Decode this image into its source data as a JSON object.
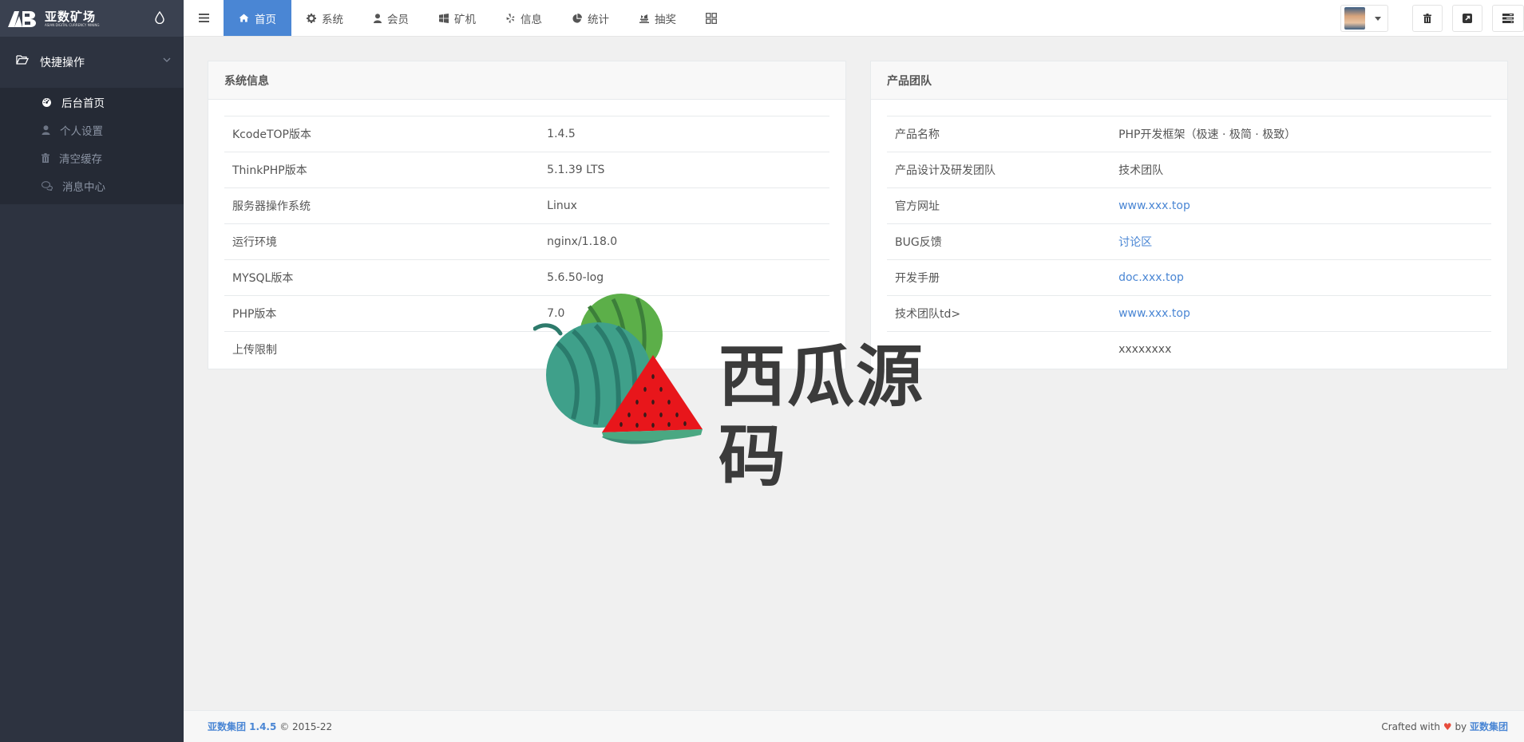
{
  "brand": {
    "title": "亚数矿场",
    "subtitle": "ASIAN DIGITAL CURRENCY MINING"
  },
  "sidebar": {
    "group_label": "快捷操作",
    "items": [
      {
        "label": "后台首页",
        "icon": "dashboard-icon",
        "active": true
      },
      {
        "label": "个人设置",
        "icon": "user-icon",
        "active": false
      },
      {
        "label": "清空缓存",
        "icon": "trash-icon",
        "active": false
      },
      {
        "label": "消息中心",
        "icon": "comments-icon",
        "active": false
      }
    ]
  },
  "nav": {
    "tabs": [
      {
        "label": "首页",
        "icon": "home-icon",
        "active": true
      },
      {
        "label": "系统",
        "icon": "gear-icon"
      },
      {
        "label": "会员",
        "icon": "user-icon"
      },
      {
        "label": "矿机",
        "icon": "windows-icon"
      },
      {
        "label": "信息",
        "icon": "yelp-icon"
      },
      {
        "label": "统计",
        "icon": "pie-chart-icon"
      },
      {
        "label": "抽奖",
        "icon": "gift-icon"
      }
    ]
  },
  "system_panel": {
    "title": "系统信息",
    "rows": [
      {
        "key": "KcodeTOP版本",
        "value": "1.4.5"
      },
      {
        "key": "ThinkPHP版本",
        "value": "5.1.39 LTS"
      },
      {
        "key": "服务器操作系统",
        "value": "Linux"
      },
      {
        "key": "运行环境",
        "value": "nginx/1.18.0"
      },
      {
        "key": "MYSQL版本",
        "value": "5.6.50-log"
      },
      {
        "key": "PHP版本",
        "value": "7.0"
      },
      {
        "key": "上传限制",
        "value": ""
      }
    ]
  },
  "team_panel": {
    "title": "产品团队",
    "rows": [
      {
        "key": "产品名称",
        "value": "PHP开发框架（极速 · 极简 · 极致）",
        "link": false
      },
      {
        "key": "产品设计及研发团队",
        "value": "技术团队",
        "link": false
      },
      {
        "key": "官方网址",
        "value": "www.xxx.top",
        "link": true
      },
      {
        "key": "BUG反馈",
        "value": "讨论区",
        "link": true
      },
      {
        "key": "开发手册",
        "value": "doc.xxx.top",
        "link": true
      },
      {
        "key": "技术团队td>",
        "value": "www.xxx.top",
        "link": true
      },
      {
        "key": "",
        "value": "xxxxxxxx",
        "link": false
      }
    ]
  },
  "watermark": {
    "text": "西瓜源码"
  },
  "footer": {
    "company": "亚数集团 1.4.5",
    "copyright": "© 2015-22",
    "crafted": "Crafted with",
    "by": "by",
    "author": "亚数集团"
  },
  "colors": {
    "accent": "#4a86d4",
    "sidebar": "#2d3340",
    "heart": "#e74c3c"
  }
}
